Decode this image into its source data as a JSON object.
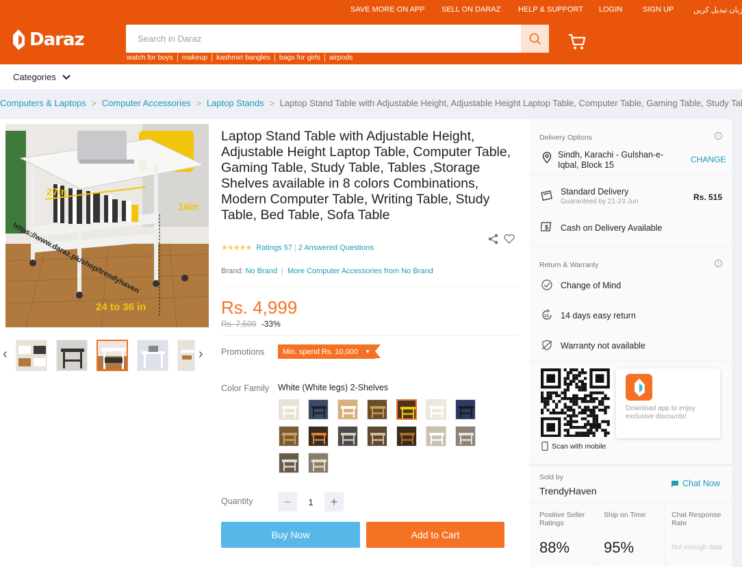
{
  "header": {
    "top_links": [
      "SAVE MORE ON APP",
      "SELL ON DARAZ",
      "HELP & SUPPORT",
      "LOGIN",
      "SIGN UP",
      "زبان تبدیل کریں"
    ],
    "logo_text": "Daraz",
    "search_placeholder": "Search in Daraz",
    "suggestions": [
      "watch for boys",
      "makeup",
      "kashmiri bangles",
      "bags for girls",
      "airpods"
    ],
    "categories_label": "Categories"
  },
  "breadcrumb": [
    "Computers & Laptops",
    "Computer Accessories",
    "Laptop Stands",
    "Laptop Stand Table with Adjustable Height, Adjustable Height Laptop Table, Computer Table, Gaming Table, Study Table,"
  ],
  "gallery": {
    "image_text": [
      "27in",
      "16in",
      "24 to 36 in",
      "https://www.daraz.pk/shop/trendyhaven"
    ],
    "thumb_count": 5,
    "selected_thumb": 2
  },
  "product": {
    "title": "Laptop Stand Table with Adjustable Height, Adjustable Height Laptop Table, Computer Table, Gaming Table, Study Table, Tables ,Storage Shelves available in 8 colors Combinations, Modern Computer Table, Writing Table, Study Table, Bed Table, Sofa Table",
    "ratings_label": "Ratings 57",
    "answered_label": "2 Answered Questions",
    "brand_label": "Brand:",
    "brand_value": "No Brand",
    "more_from": "More Computer Accessories from No Brand",
    "price": "Rs. 4,999",
    "old_price": "Rs. 7,500",
    "discount": "-33%",
    "promotions_label": "Promotions",
    "promo_text": "Min. spend Rs. 10,000",
    "color_label": "Color Family",
    "color_value": "White (White legs) 2-Shelves",
    "swatch_count": 16,
    "selected_swatch": 4,
    "quantity_label": "Quantity",
    "quantity": "1",
    "buy_now": "Buy Now",
    "add_to_cart": "Add to Cart"
  },
  "delivery": {
    "title": "Delivery Options",
    "location": "Sindh, Karachi - Gulshan-e-Iqbal, Block 15",
    "change": "CHANGE",
    "standard": "Standard Delivery",
    "guaranteed": "Guaranteed by 21-23 Jun",
    "fee": "Rs. 515",
    "cod": "Cash on Delivery Available"
  },
  "warranty": {
    "title": "Return & Warranty",
    "change_of_mind": "Change of Mind",
    "return": "14 days easy return",
    "warranty": "Warranty not available"
  },
  "app": {
    "download_text": "Download app to enjoy exclusive discounts!",
    "scan_text": "Scan with mobile"
  },
  "seller": {
    "sold_by": "Sold by",
    "name": "TrendyHaven",
    "chat": "Chat Now",
    "stats": [
      {
        "label": "Positive Seller Ratings",
        "value": "88%"
      },
      {
        "label": "Ship on Time",
        "value": "95%"
      },
      {
        "label": "Chat Response Rate",
        "value": "Not enough data"
      }
    ]
  },
  "colors": {
    "brand": "#e9560b",
    "accent": "#f57224",
    "link": "#1a9cb7",
    "buy": "#57b7e8"
  }
}
